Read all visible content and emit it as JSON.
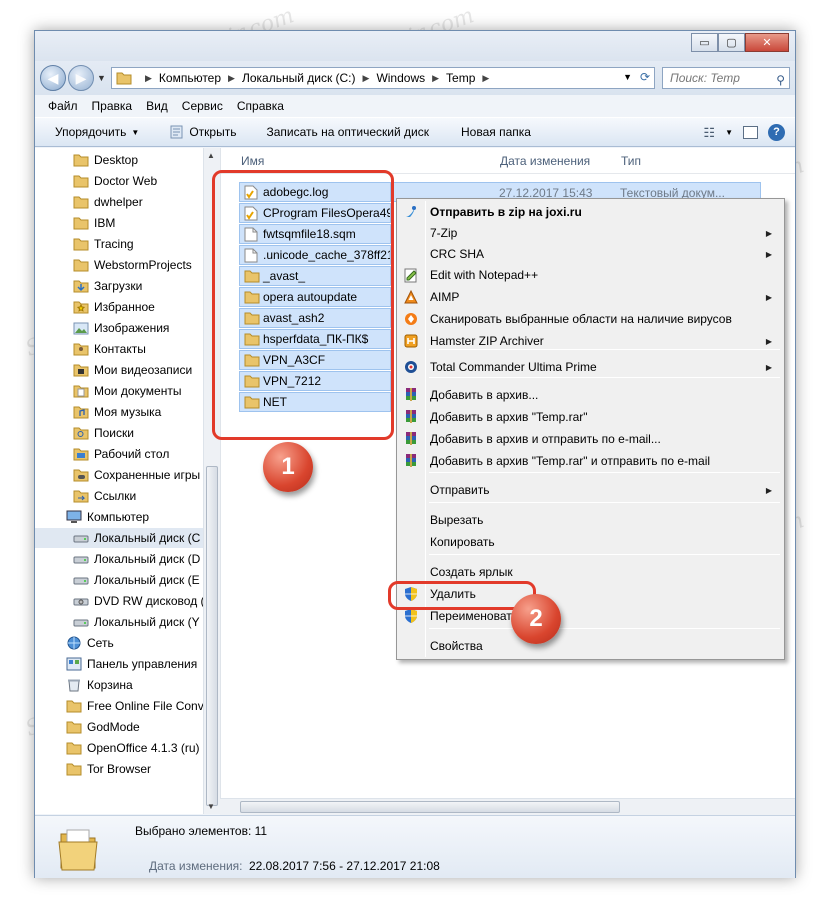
{
  "window": {
    "controls": {
      "minimize": "▭",
      "maximize": "▢",
      "close": "✕"
    }
  },
  "address": {
    "crumbs": [
      "Компьютер",
      "Локальный диск (C:)",
      "Windows",
      "Temp"
    ],
    "search_placeholder": "Поиск: Temp"
  },
  "menubar": [
    "Файл",
    "Правка",
    "Вид",
    "Сервис",
    "Справка"
  ],
  "toolbar": {
    "organize": "Упорядочить",
    "open": "Открыть",
    "burn": "Записать на оптический диск",
    "new_folder": "Новая папка"
  },
  "navpane": {
    "items": [
      {
        "label": "Desktop",
        "icon": "folder-icon"
      },
      {
        "label": "Doctor Web",
        "icon": "folder-icon"
      },
      {
        "label": "dwhelper",
        "icon": "folder-icon"
      },
      {
        "label": "IBM",
        "icon": "folder-icon"
      },
      {
        "label": "Tracing",
        "icon": "folder-icon"
      },
      {
        "label": "WebstormProjects",
        "icon": "folder-icon"
      },
      {
        "label": "Загрузки",
        "icon": "downloads-icon"
      },
      {
        "label": "Избранное",
        "icon": "favorites-icon"
      },
      {
        "label": "Изображения",
        "icon": "pictures-icon"
      },
      {
        "label": "Контакты",
        "icon": "contacts-icon"
      },
      {
        "label": "Мои видеозаписи",
        "icon": "videos-icon"
      },
      {
        "label": "Мои документы",
        "icon": "documents-icon"
      },
      {
        "label": "Моя музыка",
        "icon": "music-icon"
      },
      {
        "label": "Поиски",
        "icon": "searches-icon"
      },
      {
        "label": "Рабочий стол",
        "icon": "desktop-icon"
      },
      {
        "label": "Сохраненные игры",
        "icon": "games-icon"
      },
      {
        "label": "Ссылки",
        "icon": "links-icon"
      },
      {
        "label": "Компьютер",
        "icon": "computer-icon"
      },
      {
        "label": "Локальный диск (C",
        "icon": "drive-icon"
      },
      {
        "label": "Локальный диск (D",
        "icon": "drive-icon"
      },
      {
        "label": "Локальный диск (E",
        "icon": "drive-icon"
      },
      {
        "label": "DVD RW дисковод (",
        "icon": "dvd-icon"
      },
      {
        "label": "Локальный диск (Y",
        "icon": "drive-icon"
      },
      {
        "label": "Сеть",
        "icon": "network-icon"
      },
      {
        "label": "Панель управления",
        "icon": "control-panel-icon"
      },
      {
        "label": "Корзина",
        "icon": "recycle-bin-icon"
      },
      {
        "label": "Free Online File Conv",
        "icon": "folder-icon"
      },
      {
        "label": "GodMode",
        "icon": "folder-icon"
      },
      {
        "label": "OpenOffice 4.1.3 (ru)",
        "icon": "folder-icon"
      },
      {
        "label": "Tor Browser",
        "icon": "folder-icon"
      }
    ]
  },
  "columns": {
    "name": "Имя",
    "modified": "Дата изменения",
    "type": "Тип"
  },
  "files": [
    {
      "name": "adobegc.log",
      "icon": "log-file-icon",
      "date": "27.12.2017 15:43",
      "type": "Текстовый докум..."
    },
    {
      "name": "CProgram FilesOpera49.0",
      "icon": "log-file-icon"
    },
    {
      "name": "fwtsqmfile18.sqm",
      "icon": "file-icon"
    },
    {
      "name": ".unicode_cache_378ff213",
      "icon": "file-icon"
    },
    {
      "name": "_avast_",
      "icon": "folder-icon"
    },
    {
      "name": "opera autoupdate",
      "icon": "folder-icon"
    },
    {
      "name": "avast_ash2",
      "icon": "folder-icon"
    },
    {
      "name": "hsperfdata_ПК-ПК$",
      "icon": "folder-icon"
    },
    {
      "name": "VPN_A3CF",
      "icon": "folder-icon"
    },
    {
      "name": "VPN_7212",
      "icon": "folder-icon"
    },
    {
      "name": "NET",
      "icon": "folder-icon"
    }
  ],
  "context_menu": {
    "items": [
      {
        "label": "Отправить в zip на joxi.ru",
        "icon": "joxi-icon",
        "bold": true
      },
      {
        "label": "7-Zip",
        "submenu": true
      },
      {
        "label": "CRC SHA",
        "submenu": true
      },
      {
        "label": "Edit with Notepad++",
        "icon": "notepadpp-icon"
      },
      {
        "label": "AIMP",
        "icon": "aimp-icon",
        "submenu": true
      },
      {
        "label": "Сканировать выбранные области на наличие вирусов",
        "icon": "avast-icon"
      },
      {
        "label": "Hamster ZIP Archiver",
        "icon": "hamster-icon",
        "submenu": true
      },
      {
        "label": "Total Commander Ultima Prime",
        "icon": "total-commander-icon",
        "submenu": true
      },
      {
        "label": "Добавить в архив...",
        "icon": "winrar-icon"
      },
      {
        "label": "Добавить в архив \"Temp.rar\"",
        "icon": "winrar-icon"
      },
      {
        "label": "Добавить в архив и отправить по e-mail...",
        "icon": "winrar-icon"
      },
      {
        "label": "Добавить в архив \"Temp.rar\" и отправить по e-mail",
        "icon": "winrar-icon"
      },
      {
        "label": "Отправить",
        "submenu": true
      },
      {
        "label": "Вырезать"
      },
      {
        "label": "Копировать"
      },
      {
        "label": "Создать ярлык"
      },
      {
        "label": "Удалить",
        "icon": "shield-icon"
      },
      {
        "label": "Переименовать",
        "icon": "shield-icon"
      },
      {
        "label": "Свойства"
      }
    ]
  },
  "details": {
    "selected": "Выбрано элементов: 11",
    "date_label": "Дата изменения:",
    "date_value": "22.08.2017 7:56 - 27.12.2017 21:08"
  },
  "annotations": {
    "badge1": "1",
    "badge2": "2"
  },
  "watermark": "Soringpcrepair.com",
  "colors": {
    "highlight": "#e23a2a",
    "selection": "#cfe3fb"
  }
}
